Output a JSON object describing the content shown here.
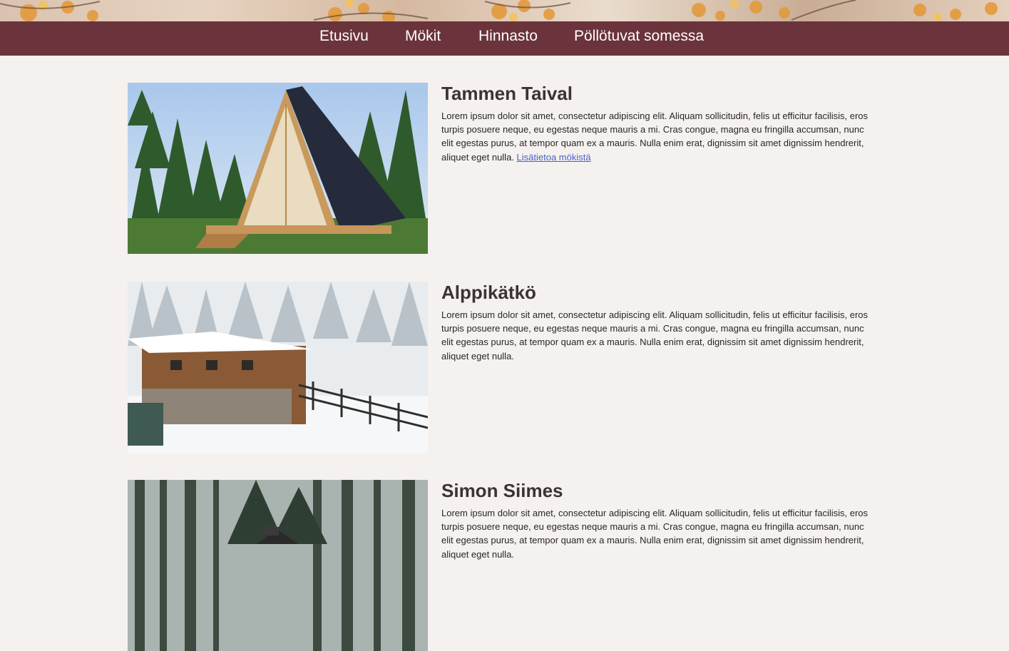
{
  "nav": {
    "items": [
      {
        "label": "Etusivu"
      },
      {
        "label": "Mökit"
      },
      {
        "label": "Hinnasto"
      },
      {
        "label": "Pöllötuvat somessa"
      }
    ]
  },
  "cabins": [
    {
      "title": "Tammen Taival",
      "text": "Lorem ipsum dolor sit amet, consectetur adipiscing elit. Aliquam sollicitudin, felis ut efficitur facilisis, eros turpis posuere neque, eu egestas neque mauris a mi. Cras congue, magna eu fringilla accumsan, nunc elit egestas purus, at tempor quam ex a mauris. Nulla enim erat, dignissim sit amet dignissim hendrerit, aliquet eget nulla.",
      "link": "Lisätietoa mökistä"
    },
    {
      "title": "Alppikätkö",
      "text": "Lorem ipsum dolor sit amet, consectetur adipiscing elit. Aliquam sollicitudin, felis ut efficitur facilisis, eros turpis posuere neque, eu egestas neque mauris a mi. Cras congue, magna eu fringilla accumsan, nunc elit egestas purus, at tempor quam ex a mauris. Nulla enim erat, dignissim sit amet dignissim hendrerit, aliquet eget nulla."
    },
    {
      "title": "Simon Siimes",
      "text": "Lorem ipsum dolor sit amet, consectetur adipiscing elit. Aliquam sollicitudin, felis ut efficitur facilisis, eros turpis posuere neque, eu egestas neque mauris a mi. Cras congue, magna eu fringilla accumsan, nunc elit egestas purus, at tempor quam ex a mauris. Nulla enim erat, dignissim sit amet dignissim hendrerit, aliquet eget nulla."
    }
  ],
  "colors": {
    "nav_bg": "#6b333b",
    "page_bg": "#f5f1ee",
    "link": "#4a5fc9"
  }
}
